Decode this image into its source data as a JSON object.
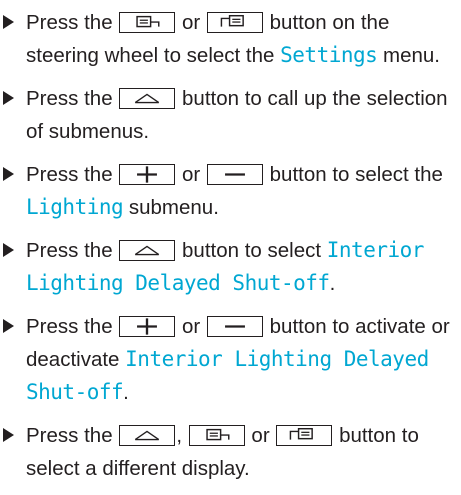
{
  "steps": [
    {
      "t1": "Press the",
      "t2": "or",
      "t3": "button on the steering wheel to select the",
      "d1": "Settings",
      "t4": "menu."
    },
    {
      "t1": "Press the",
      "t2": "button to call up the selection of submenus."
    },
    {
      "t1": "Press the",
      "t2": "or",
      "t3": "button to select the",
      "d1": "Lighting",
      "t4": "submenu."
    },
    {
      "t1": "Press the",
      "t2": "button to select",
      "d1": "Interior Lighting Delayed Shut-off",
      "t3": "."
    },
    {
      "t1": "Press the",
      "t2": "or",
      "t3": "button to activate or deactivate",
      "d1": "Interior Lighting Delayed Shut-off",
      "t4": "."
    },
    {
      "t1": "Press the",
      "t2": ",",
      "t3": "or",
      "t4": "button to select a different display."
    }
  ],
  "icons": {
    "prev_display": "previous-display-key-icon",
    "next_display": "next-display-key-icon",
    "back": "back-key-icon",
    "plus": "plus-key-icon",
    "minus": "minus-key-icon"
  },
  "colors": {
    "text": "#231f20",
    "display_text": "#00a7d2"
  }
}
